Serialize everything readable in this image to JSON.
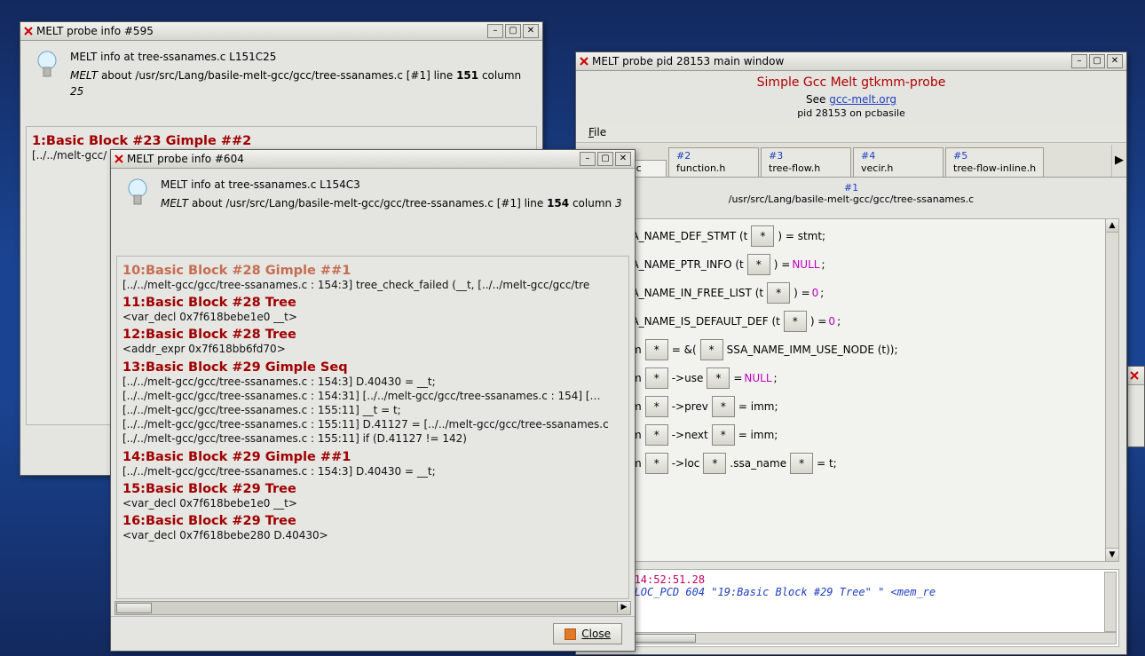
{
  "win595": {
    "title": "MELT probe info #595",
    "head_line1_prefix": "MELT info at ",
    "head_line1_loc": "tree-ssanames.c L151C25",
    "head_line2_label": "MELT",
    "head_line2_text": " about /usr/src/Lang/basile-melt-gcc/gcc/tree-ssanames.c [#1] line ",
    "head_line2_line": "151",
    "head_line2_col_label": " column ",
    "head_line2_col": "25",
    "block_heading": "1:Basic Block #23 Gimple ##2",
    "block_sub": "[../../melt-gcc/"
  },
  "win604": {
    "title": "MELT probe info #604",
    "head_line1_prefix": "MELT info at ",
    "head_line1_loc": "tree-ssanames.c L154C3",
    "head_line2_label": "MELT",
    "head_line2_text": " about /usr/src/Lang/basile-melt-gcc/gcc/tree-ssanames.c [#1] line ",
    "head_line2_line": "154",
    "head_line2_col_label": " column ",
    "head_line2_col": "3",
    "partial_heading": "10:Basic Block #28 Gimple ##1",
    "partial_sub": "[../../melt-gcc/gcc/tree-ssanames.c : 154:3] tree_check_failed (__t, [../../melt-gcc/gcc/tre",
    "blocks": [
      {
        "h": "11:Basic Block #28 Tree",
        "s": [
          "<var_decl 0x7f618bebe1e0 __t>"
        ]
      },
      {
        "h": "12:Basic Block #28 Tree",
        "s": [
          "<addr_expr 0x7f618bb6fd70>"
        ]
      },
      {
        "h": "13:Basic Block #29 Gimple Seq",
        "s": [
          "[../../melt-gcc/gcc/tree-ssanames.c : 154:3] D.40430 = __t;",
          "[../../melt-gcc/gcc/tree-ssanames.c : 154:31] [../../melt-gcc/gcc/tree-ssanames.c : 154] […",
          "[../../melt-gcc/gcc/tree-ssanames.c : 155:11] __t = t;",
          "[../../melt-gcc/gcc/tree-ssanames.c : 155:11] D.41127 = [../../melt-gcc/gcc/tree-ssanames.c",
          "[../../melt-gcc/gcc/tree-ssanames.c : 155:11] if (D.41127 != 142)"
        ]
      },
      {
        "h": "14:Basic Block #29 Gimple ##1",
        "s": [
          "[../../melt-gcc/gcc/tree-ssanames.c : 154:3] D.40430 = __t;"
        ]
      },
      {
        "h": "15:Basic Block #29 Tree",
        "s": [
          "<var_decl 0x7f618bebe1e0 __t>"
        ]
      },
      {
        "h": "16:Basic Block #29 Tree",
        "s": [
          "<var_decl 0x7f618bebe280 D.40430>"
        ]
      }
    ],
    "close_label": "Close"
  },
  "main": {
    "title": "MELT probe pid 28153 main window",
    "header_t1": "Simple Gcc Melt gtkmm-probe",
    "header_t2_pre": "See ",
    "header_t2_link": "gcc-melt.org",
    "header_t3": "pid 28153 on pcbasile",
    "menu_file": "File",
    "tabs": [
      {
        "num": "",
        "name": "ssanames.c"
      },
      {
        "num": "#2",
        "name": "function.h"
      },
      {
        "num": "#3",
        "name": "tree-flow.h"
      },
      {
        "num": "#4",
        "name": "vecir.h"
      },
      {
        "num": "#5",
        "name": "tree-flow-inline.h"
      }
    ],
    "file_num": "#1",
    "file_path": "/usr/src/Lang/basile-melt-gcc/gcc/tree-ssanames.c",
    "code": {
      "l1": {
        "a": "SSA_NAME_DEF_STMT (t",
        "b": ") = stmt;"
      },
      "l2": {
        "a": "SSA_NAME_PTR_INFO (t",
        "b": ") = ",
        "c": "NULL",
        "d": ";"
      },
      "l3": {
        "a": "SSA_NAME_IN_FREE_LIST (t",
        "b": ") = ",
        "c": "0",
        "d": ";"
      },
      "l4": {
        "a": "SSA_NAME_IS_DEFAULT_DEF (t",
        "b": ") = ",
        "c": "0",
        "d": ";"
      },
      "l5": {
        "a": "imm",
        "b": " = &(",
        "c": "SSA_NAME_IMM_USE_NODE (t));"
      },
      "l6": {
        "a": "imm",
        "b": "->use ",
        "c": "= ",
        "d": "NULL",
        "e": ";"
      },
      "l7": {
        "a": "imm",
        "b": "->prev ",
        "c": "= imm;"
      },
      "l8": {
        "a": "imm",
        "b": "->next ",
        "c": "= imm;"
      },
      "l9": {
        "a": "imm",
        "b": "->loc",
        "c": ".ssa_name ",
        "d": "= t;"
      }
    },
    "log_ts": "Aug 03 14:52:51.28",
    "log_cmd": "ADDINFOLOC_PCD 604  \"19:Basic Block #29 Tree\"    \" <mem_re"
  }
}
